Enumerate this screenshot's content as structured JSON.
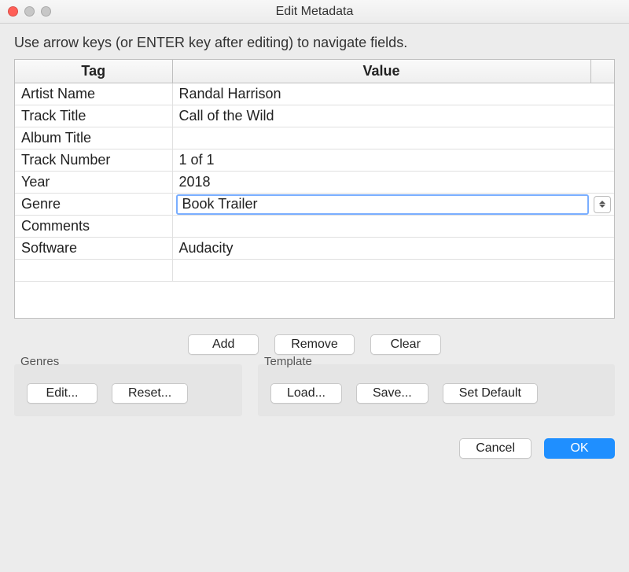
{
  "window": {
    "title": "Edit Metadata"
  },
  "instruction": "Use arrow keys (or ENTER key after editing) to navigate fields.",
  "table": {
    "headers": {
      "tag": "Tag",
      "value": "Value"
    },
    "rows": [
      {
        "tag": "Artist Name",
        "value": "Randal Harrison"
      },
      {
        "tag": "Track Title",
        "value": "Call of the Wild"
      },
      {
        "tag": "Album Title",
        "value": ""
      },
      {
        "tag": "Track Number",
        "value": "1 of 1"
      },
      {
        "tag": "Year",
        "value": "2018"
      },
      {
        "tag": "Genre",
        "value": "Book Trailer",
        "combo": true
      },
      {
        "tag": "Comments",
        "value": ""
      },
      {
        "tag": "Software",
        "value": "Audacity"
      },
      {
        "tag": "",
        "value": ""
      }
    ]
  },
  "buttons": {
    "add": "Add",
    "remove": "Remove",
    "clear": "Clear"
  },
  "groups": {
    "genres": {
      "label": "Genres",
      "edit": "Edit...",
      "reset": "Reset..."
    },
    "template": {
      "label": "Template",
      "load": "Load...",
      "save": "Save...",
      "set_default": "Set Default"
    }
  },
  "footer": {
    "cancel": "Cancel",
    "ok": "OK"
  }
}
